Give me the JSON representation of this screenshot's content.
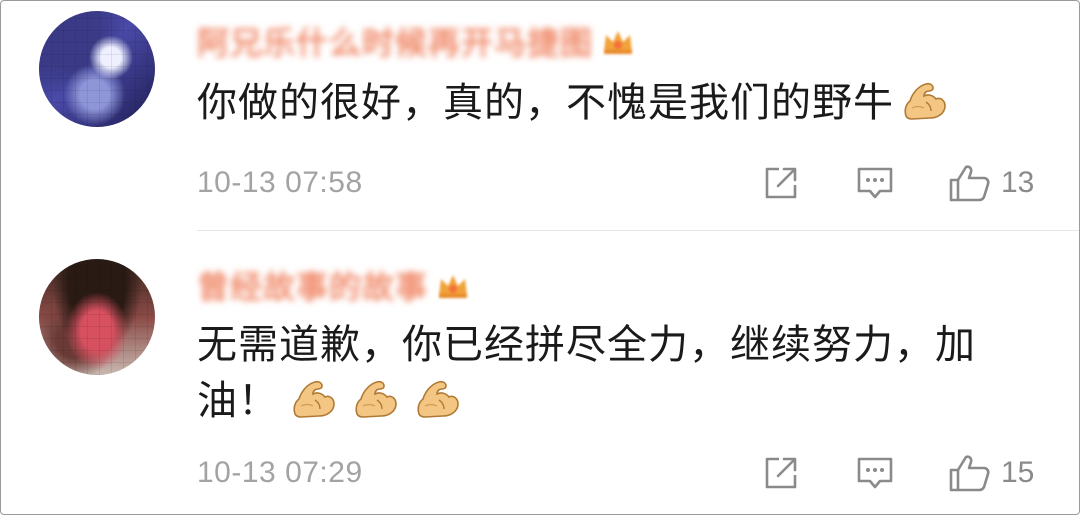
{
  "comments": [
    {
      "username": "阿兄乐什么时候再开马捷图",
      "content": "你做的很好，真的，不愧是我们的野牛",
      "emoji_icons": [
        "flexed-biceps-icon"
      ],
      "time": "10-13 07:58",
      "likes": "13",
      "avatar_icon": "avatar"
    },
    {
      "username": "曾经故事的故事",
      "content": "无需道歉，你已经拼尽全力，继续努力，加油！",
      "emoji_icons": [
        "flexed-biceps-icon",
        "flexed-biceps-icon",
        "flexed-biceps-icon"
      ],
      "time": "10-13 07:29",
      "likes": "15",
      "avatar_icon": "avatar"
    }
  ],
  "icons": {
    "share": "share-icon",
    "reply": "comment-icon",
    "like": "thumbs-up-icon",
    "badge": "crown-badge-icon"
  },
  "colors": {
    "username": "#f08a6a",
    "text": "#1a1a1a",
    "meta": "#a3a3a3",
    "icon": "#8a8a8a",
    "divider": "#e6e6e6"
  }
}
